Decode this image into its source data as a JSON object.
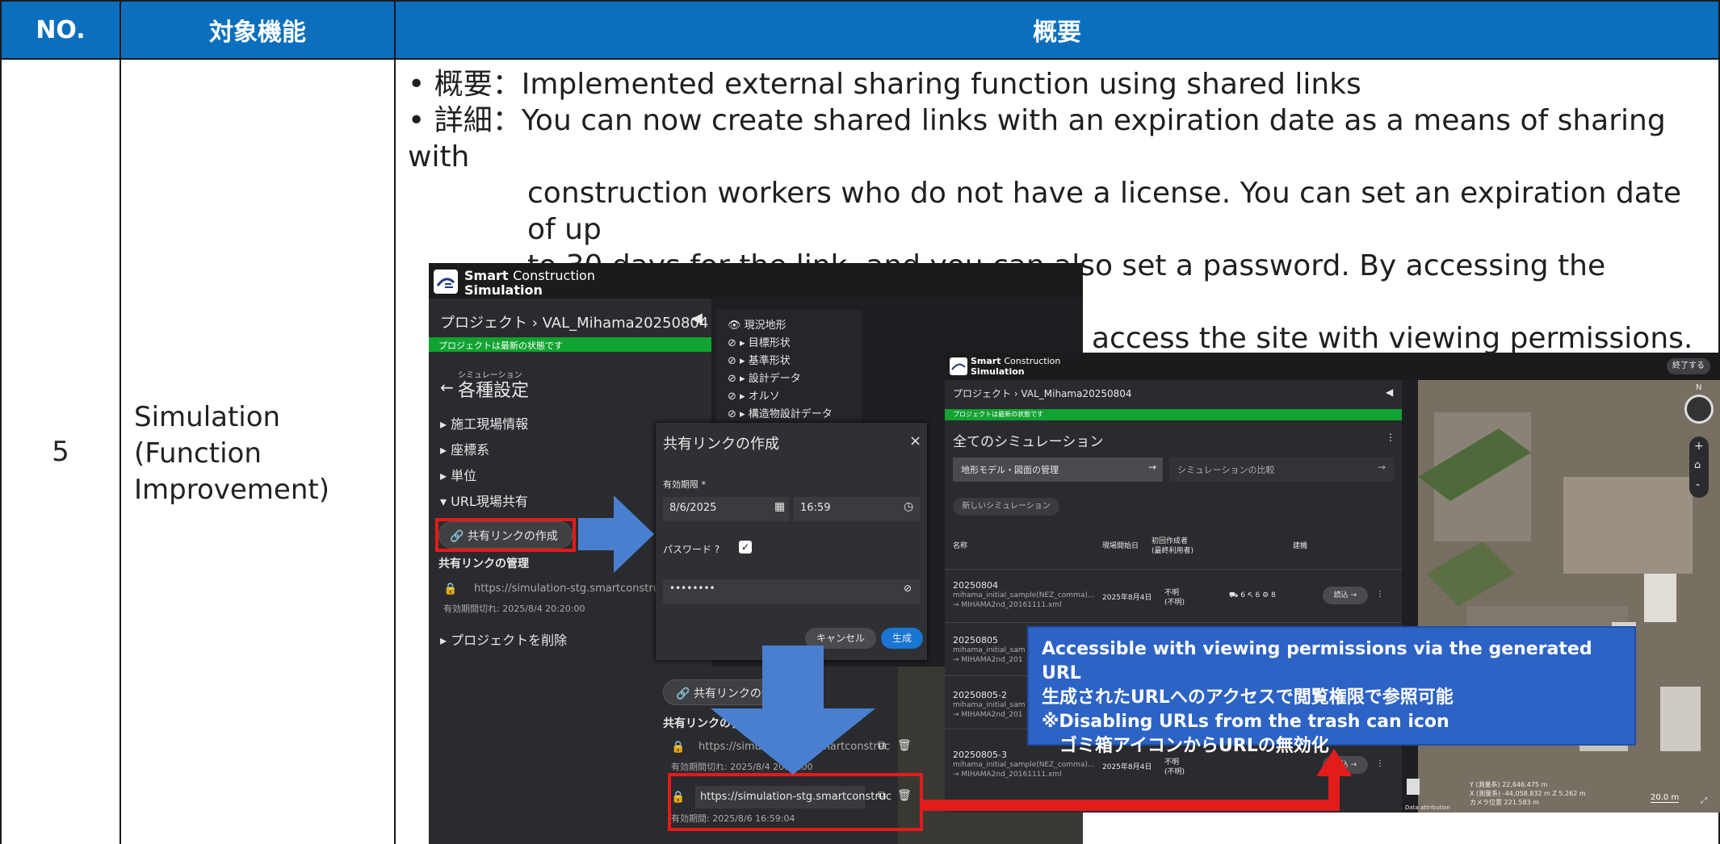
{
  "table": {
    "headers": [
      "NO.",
      "対象機能",
      "概要"
    ],
    "row_no": "5",
    "function_lines": [
      "Simulation",
      "(Function",
      "Improvement)"
    ]
  },
  "summary": {
    "label1": "概要：",
    "text1": "Implemented external sharing function using shared links",
    "label2": "詳細：",
    "detail_lines": [
      "You can now create shared links with an expiration date as a means of sharing with",
      "construction workers who do not have a license. You can set an expiration date of up",
      "to 30 days for the link, and you can also set a password. By accessing the generated",
      "URL, even those without a license can access the site with viewing permissions."
    ]
  },
  "left_app": {
    "brand1": "Smart",
    "brand2": "Construction",
    "brand3": "Simulation",
    "breadcrumb": "プロジェクト › VAL_Mihama20250804",
    "status": "プロジェクトは最新の状態です",
    "sim_small": "シミュレーション",
    "settings_title": "各種設定",
    "menu": [
      "施工現場情報",
      "座標系",
      "単位",
      "URL現場共有"
    ],
    "create_btn": "共有リンクの作成",
    "manage_title": "共有リンクの管理",
    "link1": "https://simulation-stg.smartconstruc",
    "link1_exp": "有効期間切れ: 2025/8/4 20:20:00",
    "delete_project": "プロジェクトを削除",
    "layers": [
      "現況地形",
      "目標形状",
      "基準形状",
      "設計データ",
      "オルソ",
      "構造物設計データ"
    ]
  },
  "dialog": {
    "title": "共有リンクの作成",
    "close": "×",
    "expiry_label": "有効期限 *",
    "date": "8/6/2025",
    "time": "16:59",
    "password_label": "パスワード",
    "password_value": "••••••••",
    "cancel": "キャンセル",
    "generate": "生成"
  },
  "lower": {
    "create_btn": "共有リンクの作成",
    "manage_title": "共有リンクの管理",
    "link1": "https://simulation-stg.smartconstruc",
    "link1_exp": "有効期間切れ: 2025/8/4 20:20:00",
    "link2": "https://simulation-stg.smartconstruc",
    "link2_exp": "有効期間: 2025/8/6 16:59:04"
  },
  "right_app": {
    "brand1": "Smart",
    "brand2": "Construction",
    "brand3": "Simulation",
    "exit": "終了する",
    "breadcrumb": "プロジェクト › VAL_Mihama20250804",
    "status": "プロジェクトは最新の状態です",
    "all_sims": "全てのシミュレーション",
    "tab1": "地形モデル・図面の管理",
    "tab2": "シミュレーションの比較",
    "new_sim": "新しいシミュレーション",
    "col_name": "名称",
    "col_start": "現場開始日",
    "col_creator1": "初回作成者",
    "col_creator2": "(最終利用者)",
    "col_machine": "建機",
    "rows": [
      {
        "name": "20250804",
        "sub1": "mihama_initial_sample(NEZ_comma)...",
        "sub2": "→ MIHAMA2nd_20161111.xml",
        "date": "2025年8月4日",
        "creator1": "不明",
        "creator2": "(不明)",
        "m1": "6",
        "m2": "6",
        "m3": "8",
        "load": "読込 →"
      },
      {
        "name": "20250805",
        "sub1": "mihama_initial_sam",
        "sub2": "→ MIHAMA2nd_201"
      },
      {
        "name": "20250805-2",
        "sub1": "mihama_initial_sam",
        "sub2": "→ MIHAMA2nd_201"
      },
      {
        "name": "20250805-3",
        "sub1": "mihama_initial_sample(NEZ_comma)...",
        "sub2": "→ MIHAMA2nd_20161111.xml",
        "date": "2025年8月4日",
        "creator1": "不明",
        "creator2": "(不明)",
        "load": "読込 →"
      }
    ],
    "map_coords": [
      "Y (測量系) 22,646.475 m",
      "X (測量系) -44,058.832 m   Z 5.262 m",
      "カメラ位置 221.583 m"
    ],
    "scale": "20.0 m",
    "attribution": "Data attribution"
  },
  "callout": {
    "lines": [
      "Accessible with viewing permissions via the generated URL",
      "生成されたURLへのアクセスで閲覧権限で参照可能",
      "※Disabling URLs from the trash can icon",
      "　ゴミ箱アイコンからURLの無効化"
    ]
  },
  "colors": {
    "header": "#0b6fbe",
    "arrow": "#4a7fd0",
    "highlight": "#e21b1b",
    "callout": "#2c63c4",
    "status_green": "#11a331"
  }
}
